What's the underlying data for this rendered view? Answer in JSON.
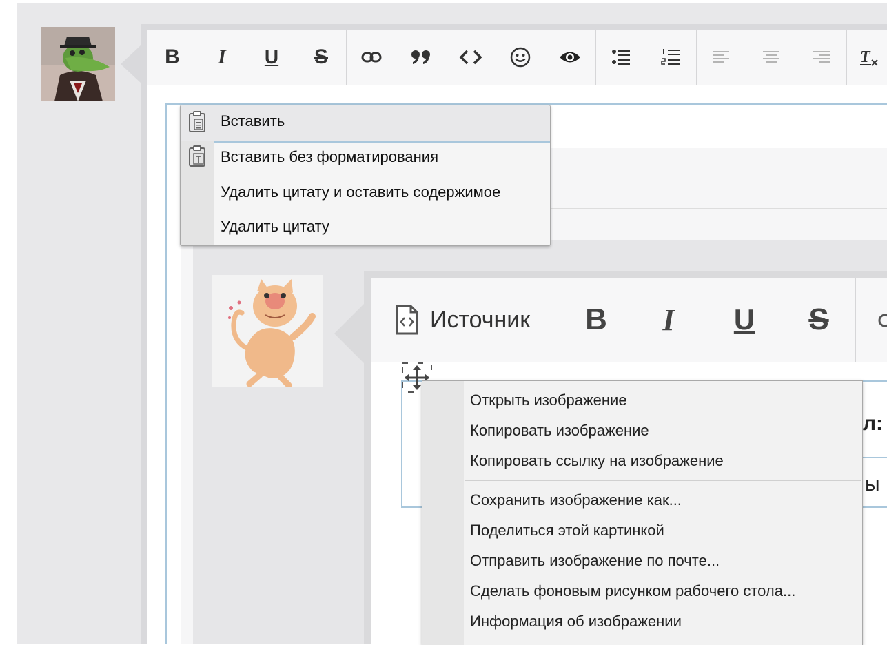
{
  "outer_toolbar": {
    "bold": "B",
    "italic": "I",
    "underline": "U",
    "strike": "S"
  },
  "paste_menu": {
    "items": [
      {
        "label": "Вставить"
      },
      {
        "label": "Вставить без форматирования"
      },
      {
        "label": "Удалить цитату и оставить содержимое"
      },
      {
        "label": "Удалить цитату"
      }
    ]
  },
  "inner_toolbar": {
    "source_label": "Источник",
    "bold": "B",
    "italic": "I",
    "underline": "U",
    "strike": "S"
  },
  "image_content": {
    "clip1": "л:",
    "clip2": "ы"
  },
  "image_menu": {
    "items": [
      {
        "label": "Открыть изображение"
      },
      {
        "label": "Копировать изображение"
      },
      {
        "label": "Копировать ссылку на изображение"
      },
      {
        "label": "Сохранить изображение как..."
      },
      {
        "label": "Поделиться этой картинкой"
      },
      {
        "label": "Отправить изображение по почте..."
      },
      {
        "label": "Сделать фоновым рисунком рабочего стола..."
      },
      {
        "label": "Информация об изображении"
      }
    ]
  },
  "colors": {
    "focus_border": "#a9c7dc",
    "toolbar_bg": "#f7f7f8",
    "menu_bg": "#f5f5f5"
  }
}
